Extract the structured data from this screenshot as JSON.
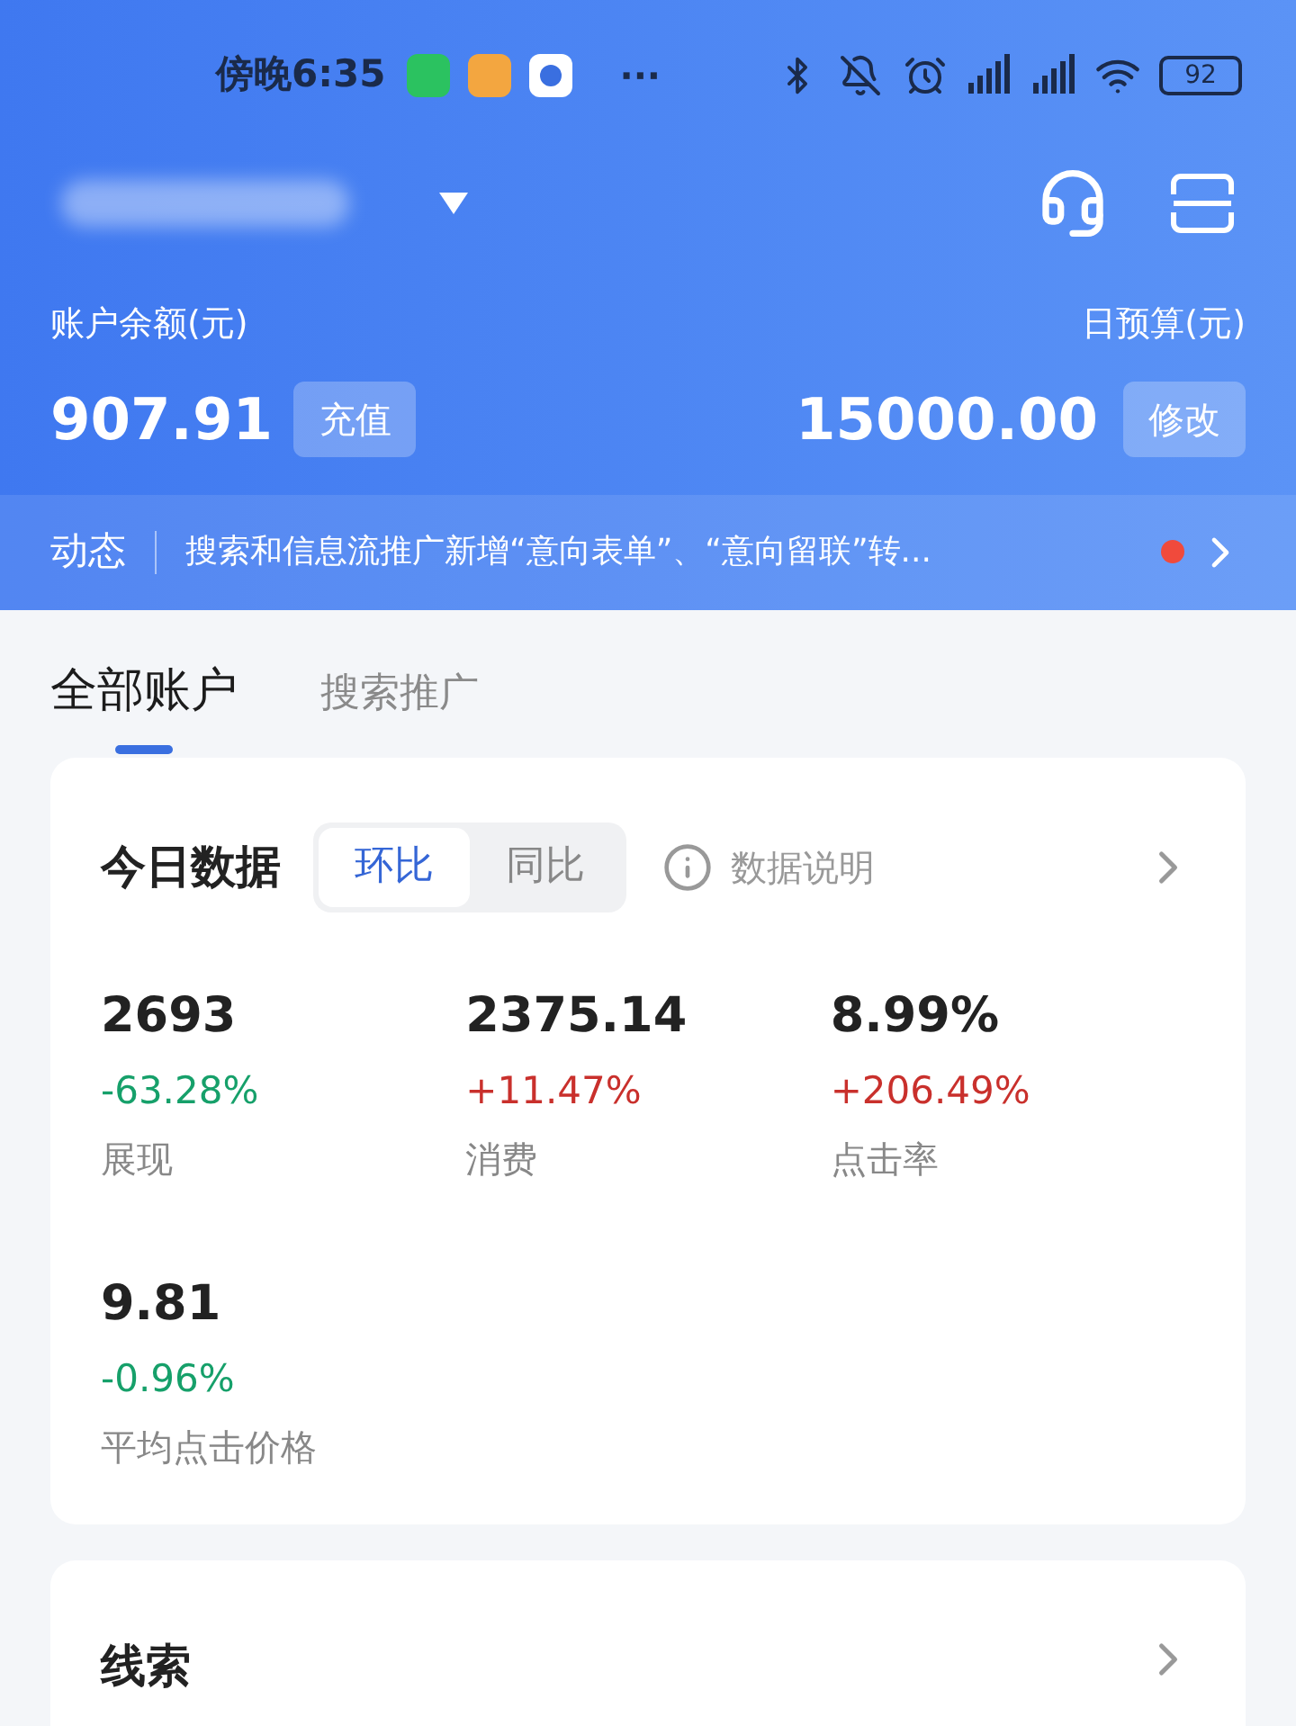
{
  "status_bar": {
    "time": "傍晚6:35",
    "more": "···",
    "battery": "92"
  },
  "balance": {
    "label": "账户余额(元)",
    "value": "907.91",
    "button": "充值"
  },
  "budget": {
    "label": "日预算(元)",
    "value": "15000.00",
    "button": "修改"
  },
  "news": {
    "label": "动态",
    "text": "搜索和信息流推广新增“意向表单”、“意向留联”转...",
    "unread": true
  },
  "tabs": [
    {
      "label": "全部账户",
      "selected": true
    },
    {
      "label": "搜索推广",
      "selected": false
    }
  ],
  "today": {
    "title": "今日数据",
    "toggle": [
      {
        "label": "环比",
        "selected": true
      },
      {
        "label": "同比",
        "selected": false
      }
    ],
    "info": "数据说明",
    "metrics": [
      {
        "figure": "2693",
        "change": "-63.28%",
        "color": "#16a06a",
        "name": "展现"
      },
      {
        "figure": "2375.14",
        "change": "+11.47%",
        "color": "#c9302c",
        "name": "消费"
      },
      {
        "figure": "8.99%",
        "change": "+206.49%",
        "color": "#c9302c",
        "name": "点击率"
      },
      {
        "figure": "9.81",
        "change": "-0.96%",
        "color": "#16a06a",
        "name": "平均点击价格"
      }
    ]
  },
  "leads": {
    "title": "线索"
  }
}
